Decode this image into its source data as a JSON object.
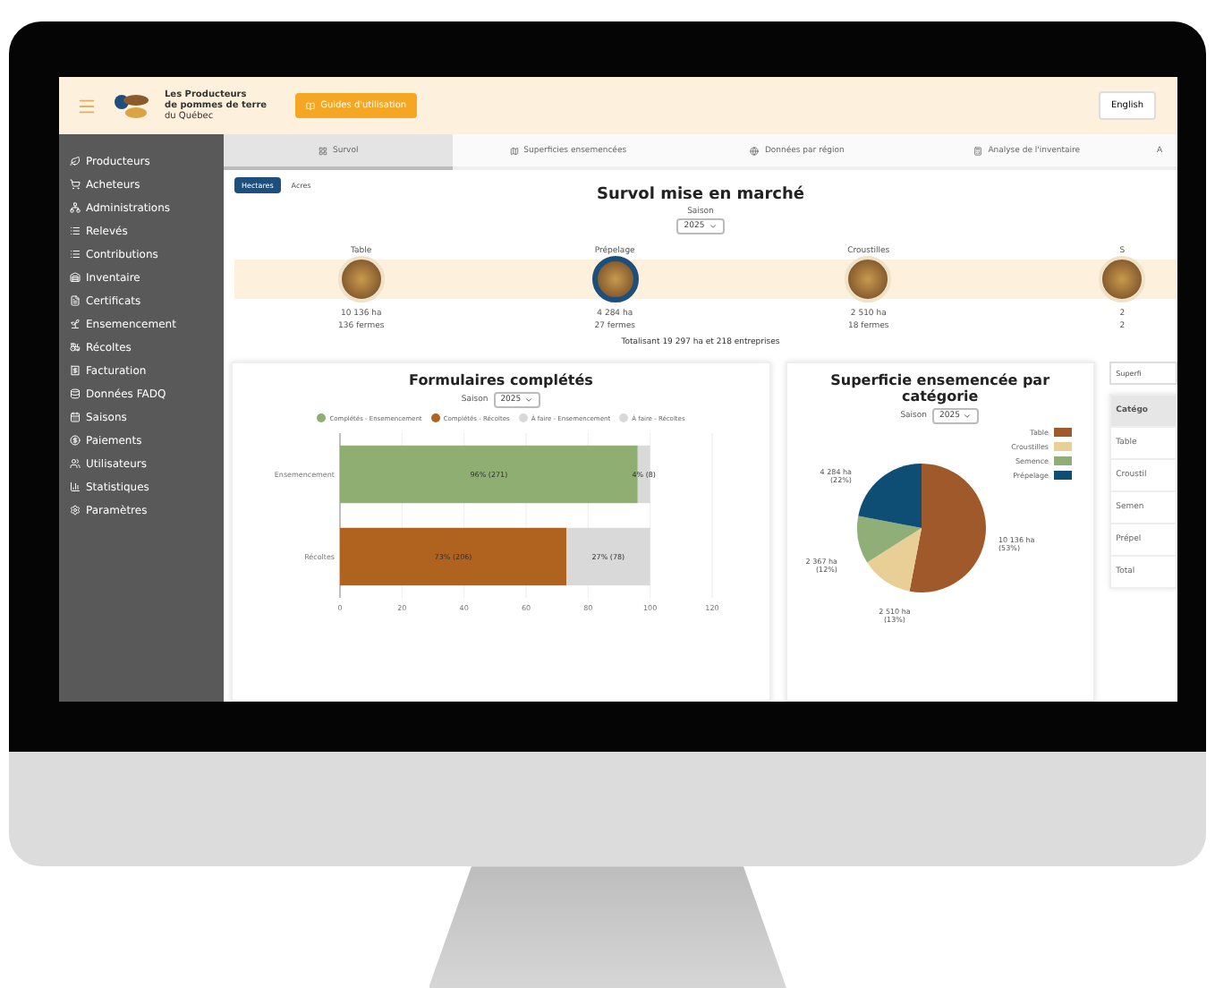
{
  "header": {
    "logo_lines": [
      "Les Producteurs",
      "de pommes de terre",
      "du Québec"
    ],
    "guide_button": "Guides d'utilisation",
    "language_button": "English"
  },
  "sidebar": {
    "items": [
      {
        "label": "Producteurs"
      },
      {
        "label": "Acheteurs"
      },
      {
        "label": "Administrations"
      },
      {
        "label": "Relevés"
      },
      {
        "label": "Contributions"
      },
      {
        "label": "Inventaire"
      },
      {
        "label": "Certificats"
      },
      {
        "label": "Ensemencement"
      },
      {
        "label": "Récoltes"
      },
      {
        "label": "Facturation"
      },
      {
        "label": "Données FADQ"
      },
      {
        "label": "Saisons"
      },
      {
        "label": "Paiements"
      },
      {
        "label": "Utilisateurs"
      },
      {
        "label": "Statistiques"
      },
      {
        "label": "Paramètres"
      }
    ]
  },
  "tabs": [
    {
      "label": "Survol",
      "selected": true
    },
    {
      "label": "Superficies ensemencées",
      "selected": false
    },
    {
      "label": "Données par région",
      "selected": false
    },
    {
      "label": "Analyse de l'inventaire",
      "selected": false
    },
    {
      "label": "A",
      "selected": false
    }
  ],
  "units": [
    {
      "label": "Hectares",
      "selected": true
    },
    {
      "label": "Acres",
      "selected": false
    }
  ],
  "overview": {
    "title": "Survol mise en marché",
    "season_label": "Saison",
    "season": "2025",
    "total": "Totalisant 19 297 ha et 218 entreprises",
    "categories": [
      {
        "name": "Table",
        "area": "10 136 ha",
        "farms": "136 fermes",
        "selected": false
      },
      {
        "name": "Prépelage",
        "area": "4 284 ha",
        "farms": "27 fermes",
        "selected": true
      },
      {
        "name": "Croustilles",
        "area": "2 510 ha",
        "farms": "18 fermes",
        "selected": false
      },
      {
        "name": "S",
        "area": "2",
        "farms": "2",
        "selected": false
      }
    ]
  },
  "forms_card": {
    "title": "Formulaires complétés",
    "season_label": "Saison",
    "season": "2025",
    "chart_data": {
      "type": "bar",
      "orientation": "horizontal",
      "stacked": true,
      "grid": true,
      "categories": [
        "Ensemencement",
        "Récoltes"
      ],
      "xlim": [
        0,
        120
      ],
      "xticks": [
        0,
        20,
        40,
        60,
        80,
        100,
        120
      ],
      "series": [
        {
          "name": "Complétés - Ensemencement",
          "color": "#8fae72",
          "values": [
            96,
            null
          ]
        },
        {
          "name": "Complétés - Récoltes",
          "color": "#b0621f",
          "values": [
            null,
            73
          ]
        },
        {
          "name": "À faire - Ensemencement",
          "color": "#d9d9d9",
          "values": [
            4,
            null
          ]
        },
        {
          "name": "À faire - Récoltes",
          "color": "#d9d9d9",
          "values": [
            null,
            27
          ]
        }
      ],
      "annotations": [
        "96% (271)",
        "4% (8)",
        "73% (206)",
        "27% (78)"
      ]
    }
  },
  "area_card": {
    "title": "Superficie ensemencée par catégorie",
    "season_label": "Saison",
    "season": "2025",
    "chart_data": {
      "type": "pie",
      "legend": true,
      "categories": [
        "Table",
        "Croustilles",
        "Semence",
        "Prépelage"
      ],
      "series": [
        {
          "values": [
            53,
            13,
            12,
            22
          ]
        }
      ],
      "colors": [
        "#a0592a",
        "#e8cf95",
        "#8fae78",
        "#0e4d74"
      ],
      "value_labels": [
        "10 136 ha (53%)",
        "2 510 ha (13%)",
        "2 367 ha (12%)",
        "4 284 ha (22%)"
      ]
    }
  },
  "side_table": {
    "select": "Superfi",
    "header": "Catégo",
    "rows": [
      "Table",
      "Croustil",
      "Semen",
      "Prépel",
      "Total"
    ]
  }
}
